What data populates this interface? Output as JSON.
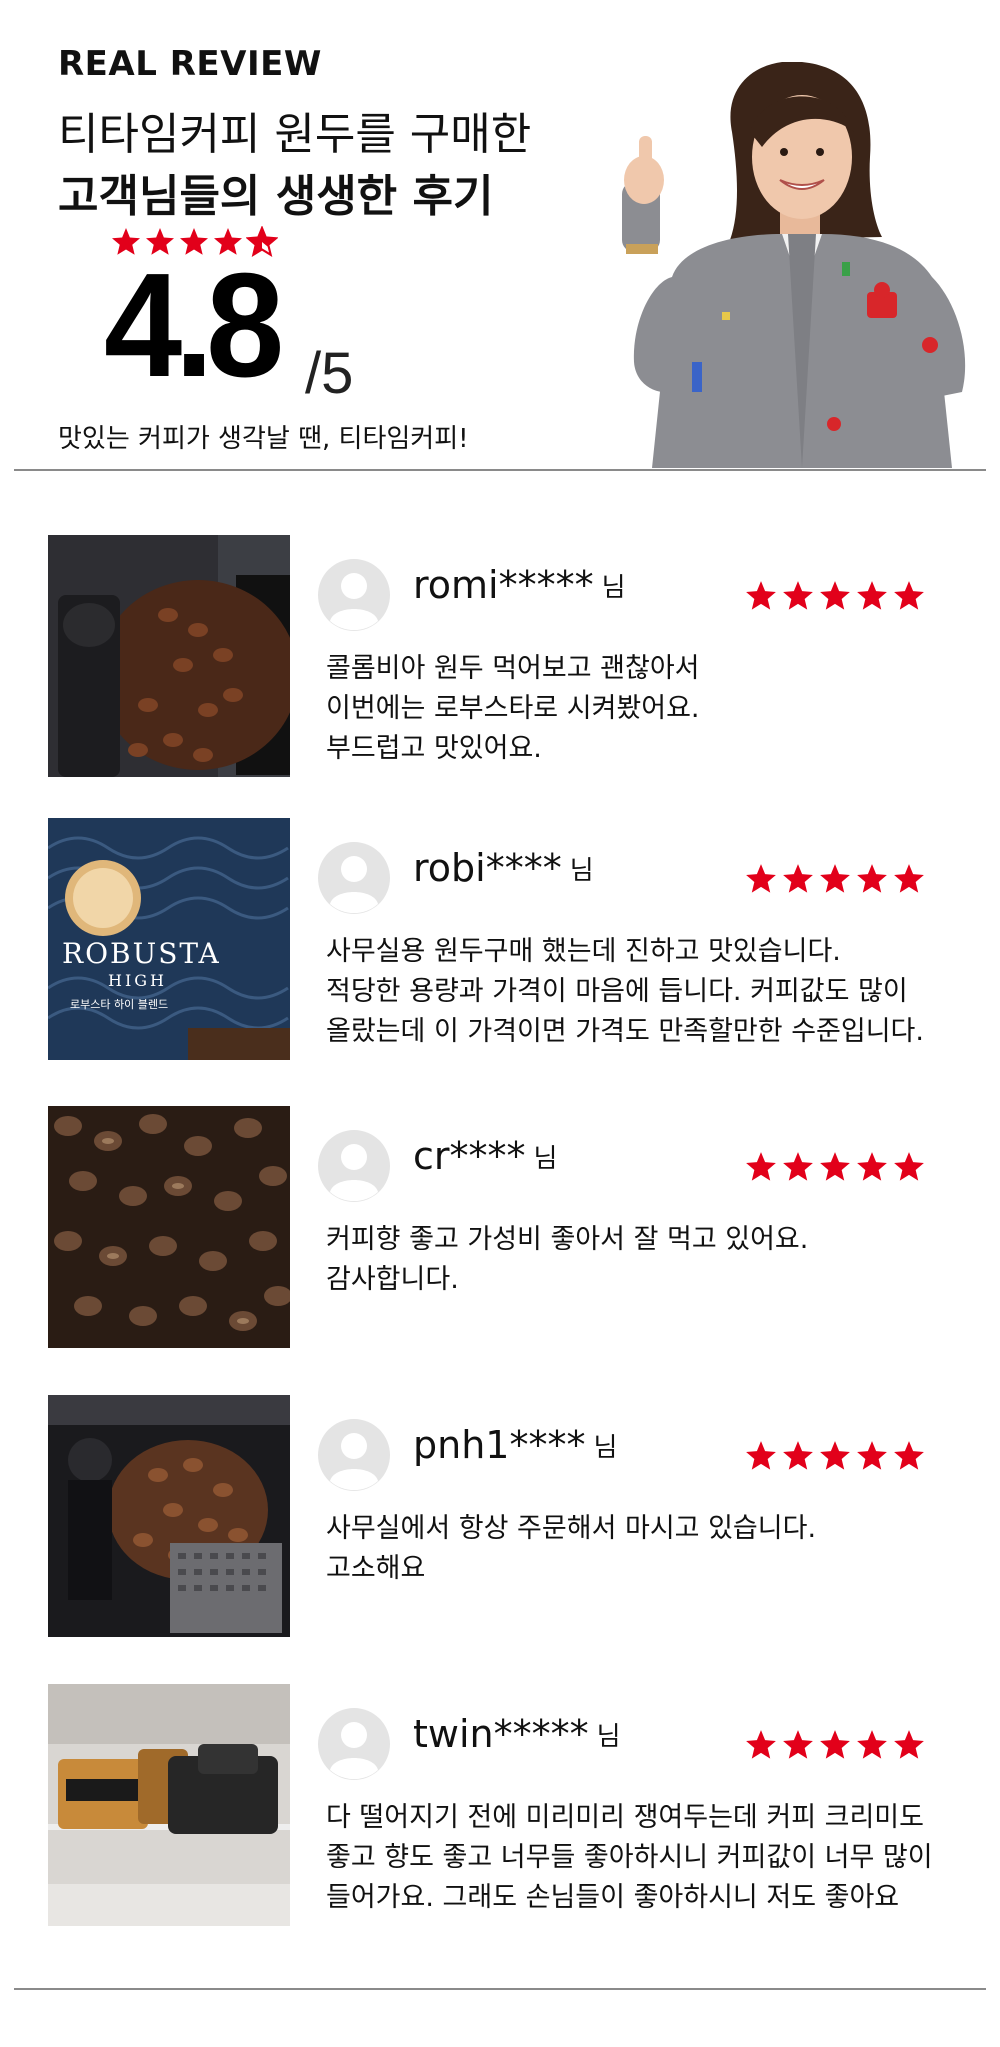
{
  "header": {
    "eyebrow": "REAL REVIEW",
    "headline_line1": "티타임커피 원두를 구매한",
    "headline_line2": "고객님들의 생생한 후기",
    "rating": "4.8",
    "rating_max": "/5",
    "rating_stars": 4.8,
    "tagline": "맛있는 커피가 생각날 땐, 티타임커피!"
  },
  "colors": {
    "star": "#e2001a",
    "divider": "#8a8a8a",
    "text": "#111111"
  },
  "honorific": "님",
  "reviews": [
    {
      "username": "romi*****",
      "rating": 5,
      "lines": [
        "콜롬비아 원두 먹어보고 괜찮아서",
        "이번에는 로부스타로 시켜봤어요.",
        "부드럽고 맛있어요."
      ]
    },
    {
      "username": "robi****",
      "rating": 5,
      "package_title": "ROBUSTA",
      "package_subtitle": "HIGH",
      "package_korean": "로부스타 하이 블렌드",
      "lines": [
        "사무실용 원두구매 했는데 진하고 맛있습니다.",
        "적당한 용량과 가격이 마음에 듭니다. 커피값도 많이",
        "올랐는데 이 가격이면 가격도 만족할만한 수준입니다."
      ]
    },
    {
      "username": "cr****",
      "rating": 5,
      "lines": [
        "커피향 좋고 가성비 좋아서 잘 먹고 있어요.",
        "감사합니다."
      ]
    },
    {
      "username": "pnh1****",
      "rating": 5,
      "lines": [
        "사무실에서 항상 주문해서 마시고 있습니다.",
        "고소해요"
      ]
    },
    {
      "username": "twin*****",
      "rating": 5,
      "lines": [
        "다 떨어지기 전에 미리미리 쟁여두는데 커피 크리미도",
        "좋고 향도 좋고 너무들 좋아하시니 커피값이 너무 많이",
        "들어가요. 그래도 손님들이 좋아하시니 저도 좋아요"
      ]
    }
  ]
}
